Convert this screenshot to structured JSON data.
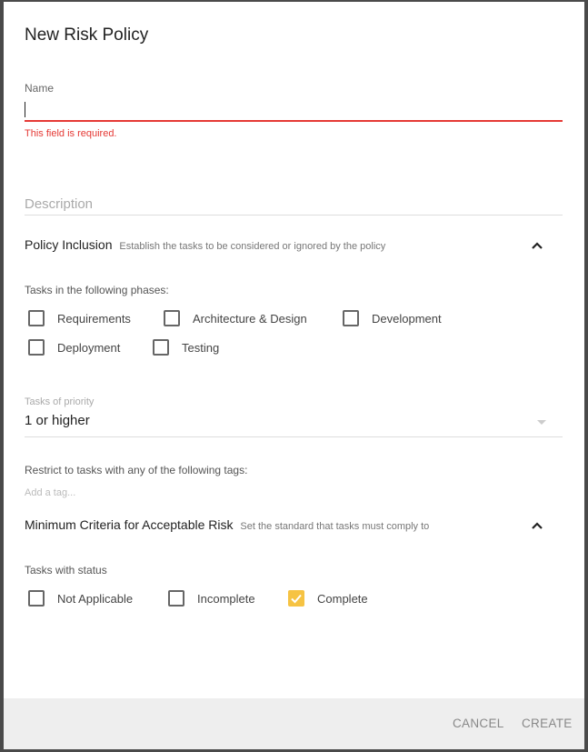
{
  "dialog": {
    "title": "New Risk Policy",
    "name_label": "Name",
    "name_value": "",
    "name_error": "This field is required.",
    "description_placeholder": "Description",
    "accent_color": "#f6c343",
    "error_color": "#e53935"
  },
  "policy_inclusion": {
    "title": "Policy Inclusion",
    "subtitle": "Establish the tasks to be considered or ignored by the policy",
    "expand_icon": "chevron-up-icon",
    "phases_label": "Tasks in the following phases:",
    "phases": [
      {
        "label": "Requirements",
        "checked": false
      },
      {
        "label": "Architecture & Design",
        "checked": false
      },
      {
        "label": "Development",
        "checked": false
      },
      {
        "label": "Deployment",
        "checked": false
      },
      {
        "label": "Testing",
        "checked": false
      }
    ],
    "priority_label": "Tasks of priority",
    "priority_value": "1 or higher",
    "tags_label": "Restrict to tasks with any of the following tags:",
    "tags_placeholder": "Add a tag..."
  },
  "criteria": {
    "title": "Minimum Criteria for Acceptable Risk",
    "subtitle": "Set the standard that tasks must comply to",
    "expand_icon": "chevron-up-icon",
    "status_label": "Tasks with status",
    "statuses": [
      {
        "label": "Not Applicable",
        "checked": false
      },
      {
        "label": "Incomplete",
        "checked": false
      },
      {
        "label": "Complete",
        "checked": true
      }
    ]
  },
  "footer": {
    "cancel_label": "CANCEL",
    "create_label": "CREATE"
  }
}
